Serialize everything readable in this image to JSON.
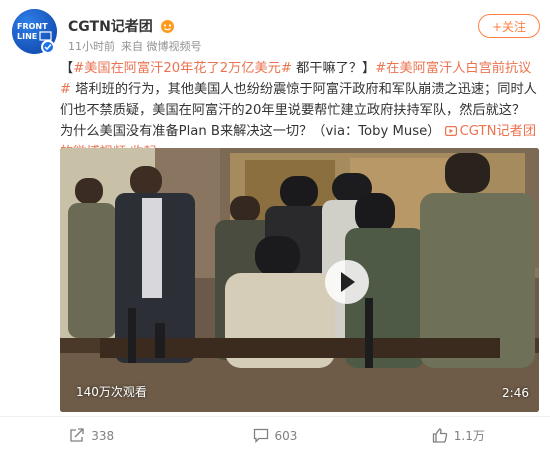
{
  "account": {
    "name": "CGTN记者团",
    "avatar_text_line1": "FRONT",
    "avatar_text_line2": "LINE",
    "time": "11小时前",
    "source": "来自 微博视频号",
    "follow_label": "+关注"
  },
  "post": {
    "open_bracket": "【",
    "hashtag1": "#美国在阿富汗20年花了2万亿美元#",
    "text1": " 都干嘛了？】",
    "hashtag2": "#在美阿富汗人白宫前抗议#",
    "text2": " 塔利班的行为，其他美国人也纷纷震惊于阿富汗政府和军队崩溃之迅速；同时人们也不禁质疑，美国在阿富汗的20年里说要帮忙建立政府扶持军队，然后就这？为什么美国没有准备Plan B来解决这一切？（via：Toby Muse）",
    "video_link": "CGTN记者团的微博视频",
    "collapse": "收起"
  },
  "video": {
    "views": "140万次观看",
    "duration": "2:46"
  },
  "actions": {
    "share_count": "338",
    "comment_count": "603",
    "like_count": "1.1万"
  },
  "colors": {
    "accent": "#eb7350",
    "follow": "#ff8140",
    "verified": "#1a73e8",
    "muted": "#939393"
  },
  "icons": [
    "frontline-logo-icon",
    "verified-icon",
    "vip-badge-icon",
    "video-link-icon",
    "play-icon",
    "share-icon",
    "comment-icon",
    "like-icon"
  ]
}
